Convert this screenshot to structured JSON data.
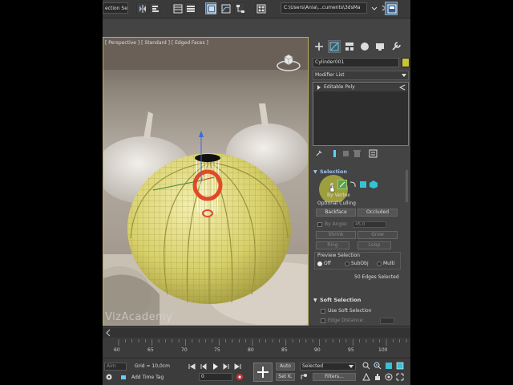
{
  "toolbar": {
    "selection_set": "ection Set",
    "project_path": "C:\\Users\\Ania\\...cuments\\3dsMa"
  },
  "viewport": {
    "label": "[ Perspective ] [ Standard ] [ Edged Faces ]",
    "watermark": "VizAcademy"
  },
  "command_panel": {
    "object_name": "Cylinder001",
    "object_color": "#c9c33c",
    "modifier_list": "Modifier List",
    "stack": [
      "Editable Poly"
    ],
    "selection": {
      "title": "Selection",
      "by_vertex": "By Vertex",
      "optional_culling": "Optional Culling",
      "backface": "Backface",
      "occluded": "Occluded",
      "by_angle": "By Angle:",
      "angle_value": "45,0",
      "shrink": "Shrink",
      "grow": "Grow",
      "ring": "Ring",
      "loop": "Loop",
      "preview_selection": "Preview Selection",
      "off": "Off",
      "subobj": "SubObj",
      "multi": "Multi",
      "status": "50 Edges Selected"
    },
    "soft_selection": {
      "title": "Soft Selection",
      "use_soft": "Use Soft Selection",
      "edge_distance": "Edge Distance:"
    }
  },
  "timeline": {
    "ticks": [
      "60",
      "65",
      "70",
      "75",
      "80",
      "85",
      "90",
      "95",
      "100"
    ]
  },
  "status_bar": {
    "aim": "Aim",
    "grid": "Grid = 10,0cm",
    "add_time_tag": "Add Time Tag",
    "auto": "Auto",
    "set_key": "Set K.",
    "selected": "Selected",
    "filters": "Filters...",
    "frame": "0"
  },
  "colors": {
    "accent": "#9fc4ef",
    "object": "#c9c33c",
    "selection_highlight": "#e04a2a"
  }
}
